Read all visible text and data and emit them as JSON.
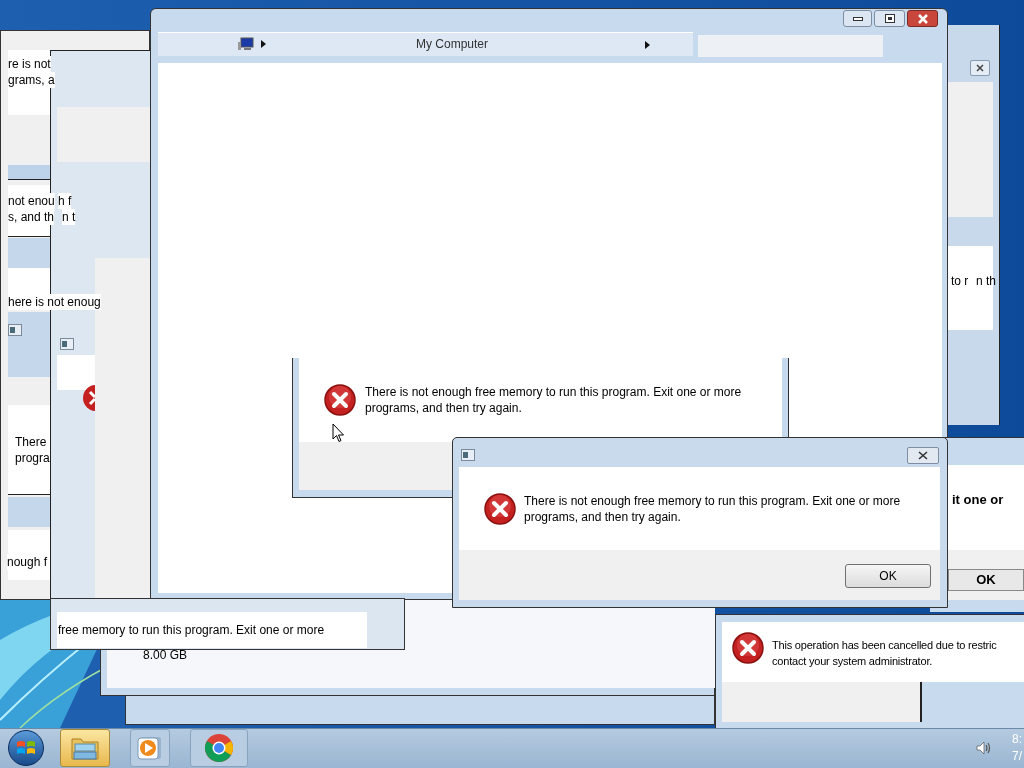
{
  "left_fragments": [
    "re is not",
    "grams, a",
    "not enou",
    "h f",
    "s, and th",
    "n t",
    "here is not enoug",
    "There",
    "progra",
    "nough f"
  ],
  "explorer_window": {
    "breadcrumb": "My Computer"
  },
  "back_dialog": {
    "message": [
      "There is not enough free memory to run this program. Exit one or more",
      "programs, and then try again."
    ]
  },
  "front_dialog": {
    "message": [
      "There is not enough free memory to run this program. Exit one or more",
      "programs, and then try again."
    ],
    "button": "OK"
  },
  "right_dialog": {
    "message_fragment": "it one or",
    "button": "OK"
  },
  "right_fragments": [
    "to r",
    "n th"
  ],
  "bottom_window": {
    "text": "free memory to run this program. Exit one or more"
  },
  "system_window": {
    "memory": "8.00 GB"
  },
  "restriction_dialog": {
    "message": [
      "This operation has been cancelled due to restric",
      "contact your system administrator."
    ]
  },
  "taskbar": {
    "items": [
      {
        "kind": "explorer",
        "selected": true
      },
      {
        "kind": "media",
        "selected": false
      },
      {
        "kind": "chrome",
        "selected": false
      }
    ],
    "clock": [
      "8:",
      "7/"
    ]
  }
}
